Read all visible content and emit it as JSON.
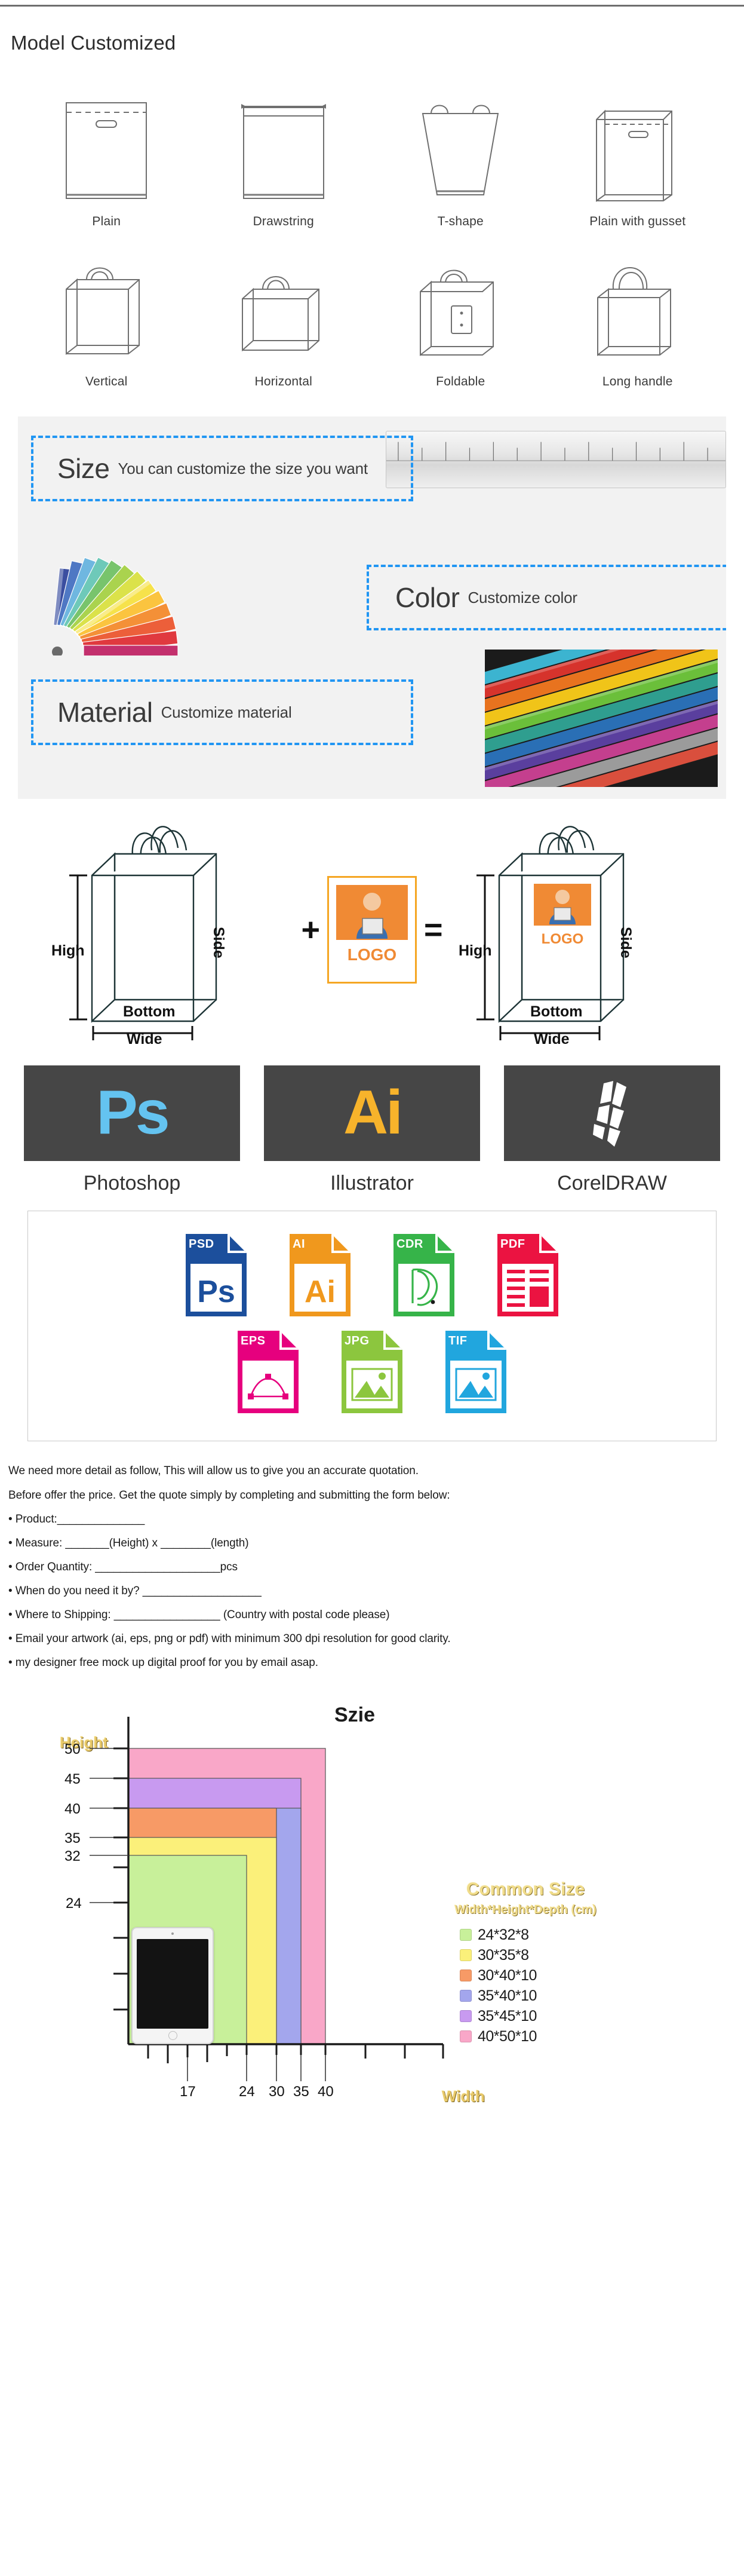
{
  "section_models": {
    "title": "Model Customized",
    "items": [
      {
        "label": "Plain",
        "shape": "plain"
      },
      {
        "label": "Drawstring",
        "shape": "drawstring"
      },
      {
        "label": "T-shape",
        "shape": "t-shape"
      },
      {
        "label": "Plain with gusset",
        "shape": "plain-gusset"
      },
      {
        "label": "Vertical",
        "shape": "vertical"
      },
      {
        "label": "Horizontal",
        "shape": "horizontal"
      },
      {
        "label": "Foldable",
        "shape": "foldable"
      },
      {
        "label": "Long handle",
        "shape": "long-handle"
      }
    ]
  },
  "section_customize": {
    "accent_color": "#2196f3",
    "panel_bg": "#f2f2f2",
    "boxes": [
      {
        "title": "Size",
        "desc": "You can customize the size you want"
      },
      {
        "title": "Color",
        "desc": "Customize color"
      },
      {
        "title": "Material",
        "desc": "Customize material"
      }
    ]
  },
  "section_dimensions": {
    "bag_labels": {
      "high": "High",
      "side": "Side",
      "bottom": "Bottom",
      "wide": "Wide"
    },
    "logo_text": "LOGO",
    "operator_plus": "+",
    "operator_equals": "="
  },
  "section_software": {
    "items": [
      {
        "name": "Photoshop",
        "mark": "Ps",
        "mark_color": "#64c3f0",
        "tile_color": "#464646"
      },
      {
        "name": "Illustrator",
        "mark": "Ai",
        "mark_color": "#f7b32b",
        "tile_color": "#464646"
      },
      {
        "name": "CorelDRAW",
        "mark": "",
        "mark_color": "#ffffff",
        "tile_color": "#464646"
      }
    ]
  },
  "section_formats": {
    "row1": [
      {
        "label": "PSD",
        "color": "#1c4f9c",
        "glyph": "Ps"
      },
      {
        "label": "AI",
        "color": "#f0981d",
        "glyph": "Ai"
      },
      {
        "label": "CDR",
        "color": "#36b449",
        "glyph": "cdr"
      },
      {
        "label": "PDF",
        "color": "#eb1341",
        "glyph": "lines"
      }
    ],
    "row2": [
      {
        "label": "EPS",
        "color": "#e6007e",
        "glyph": "nodes"
      },
      {
        "label": "JPG",
        "color": "#8cc63e",
        "glyph": "photo"
      },
      {
        "label": "TIF",
        "color": "#21a6de",
        "glyph": "photo"
      }
    ]
  },
  "section_quote": {
    "intro_line_1": "We need more detail as follow, This will allow us to give you an accurate quotation.",
    "intro_line_2": "Before offer the price. Get the quote simply by completing and submitting the form below:",
    "bullets": [
      "Product:______________",
      "Measure: _______(Height) x ________(length)",
      "Order Quantity: ____________________pcs",
      "When do you need it by? ___________________",
      "Where to Shipping: _________________ (Country with postal code please)",
      "Email your artwork (ai, eps, png or pdf) with minimum 300 dpi resolution for good clarity.",
      "my designer free mock up digital proof for you by email asap."
    ]
  },
  "chart_data": {
    "type": "bar",
    "title": "Szie",
    "xlabel": "Width",
    "ylabel": "Height",
    "unit": "cm",
    "legend_title": "Common Size",
    "legend_subtitle": "Width*Height*Depth (cm)",
    "legend_position": "right",
    "grid": false,
    "xlim": [
      0,
      48
    ],
    "ylim": [
      0,
      58
    ],
    "xticks": [
      17,
      24,
      30,
      35,
      40
    ],
    "yticks": [
      24,
      32,
      35,
      40,
      45,
      50
    ],
    "series": [
      {
        "name": "24*32*8",
        "width": 24,
        "height": 32,
        "depth": 8,
        "color": "#c8f09a"
      },
      {
        "name": "30*35*8",
        "width": 30,
        "height": 35,
        "depth": 8,
        "color": "#fbf07a"
      },
      {
        "name": "30*40*10",
        "width": 30,
        "height": 40,
        "depth": 10,
        "color": "#f79a66"
      },
      {
        "name": "35*40*10",
        "width": 35,
        "height": 40,
        "depth": 10,
        "color": "#a3a6ed"
      },
      {
        "name": "35*45*10",
        "width": 35,
        "height": 45,
        "depth": 10,
        "color": "#c89af0"
      },
      {
        "name": "40*50*10",
        "width": 40,
        "height": 50,
        "depth": 10,
        "color": "#f9a7c8"
      }
    ],
    "reference_object": {
      "name": "tablet",
      "width": 17,
      "height": 24
    }
  }
}
